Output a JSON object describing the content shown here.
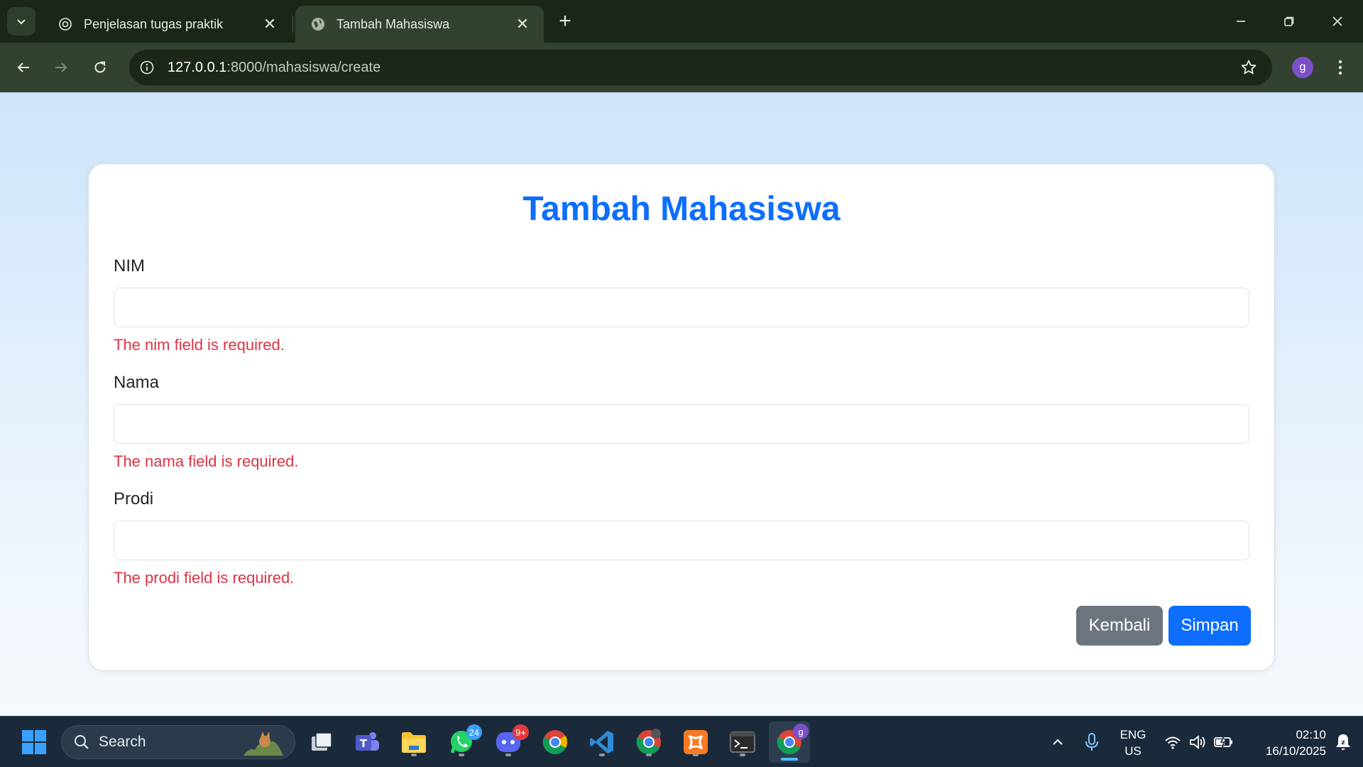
{
  "browser": {
    "tabs": [
      {
        "title": "Penjelasan tugas praktik",
        "icon": "openai-icon",
        "active": false
      },
      {
        "title": "Tambah Mahasiswa",
        "icon": "globe-icon",
        "active": true
      }
    ],
    "url_host": "127.0.0.1",
    "url_path": ":8000/mahasiswa/create",
    "profile_initial": "g"
  },
  "page": {
    "title": "Tambah Mahasiswa",
    "fields": [
      {
        "label": "NIM",
        "value": "",
        "error": "The nim field is required."
      },
      {
        "label": "Nama",
        "value": "",
        "error": "The nama field is required."
      },
      {
        "label": "Prodi",
        "value": "",
        "error": "The prodi field is required."
      }
    ],
    "buttons": {
      "back": "Kembali",
      "save": "Simpan"
    },
    "colors": {
      "primary": "#0d6efd",
      "secondary": "#6c757d",
      "error": "#dc3545"
    }
  },
  "taskbar": {
    "search_placeholder": "Search",
    "apps": [
      {
        "name": "task-view",
        "badge": ""
      },
      {
        "name": "teams",
        "badge": ""
      },
      {
        "name": "file-explorer",
        "badge": ""
      },
      {
        "name": "whatsapp",
        "badge": "24"
      },
      {
        "name": "discord",
        "badge": "9+"
      },
      {
        "name": "chrome",
        "badge": ""
      },
      {
        "name": "vscode",
        "badge": ""
      },
      {
        "name": "chrome-profile",
        "badge": ""
      },
      {
        "name": "xampp",
        "badge": ""
      },
      {
        "name": "terminal",
        "badge": ""
      },
      {
        "name": "chrome-active",
        "badge": "g"
      }
    ],
    "tray": {
      "lang_line1": "ENG",
      "lang_line2": "US",
      "time": "02:10",
      "date": "16/10/2025"
    }
  }
}
